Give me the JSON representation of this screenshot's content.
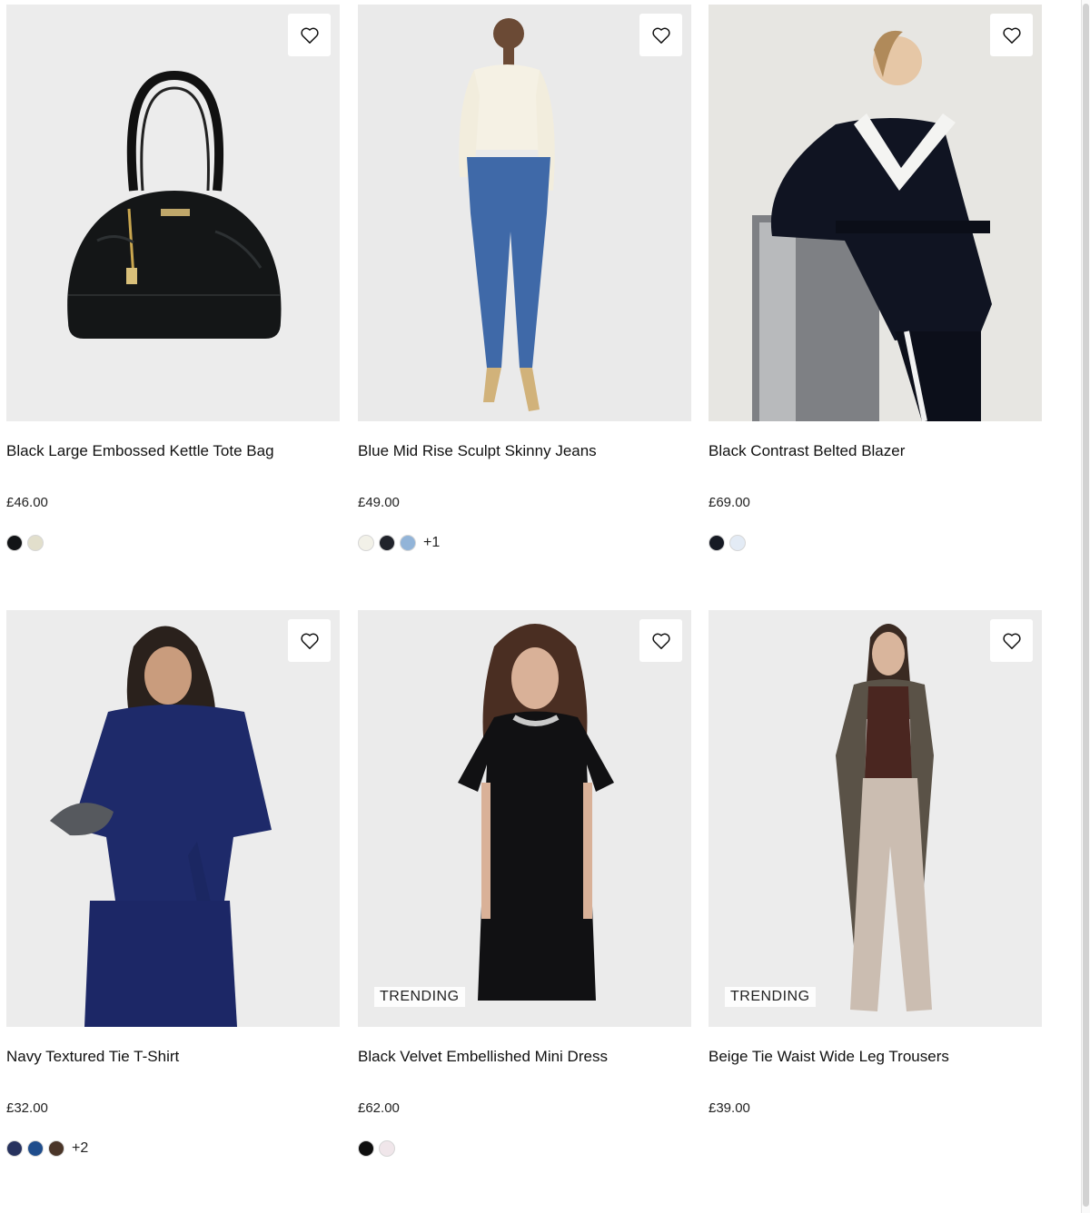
{
  "products": [
    {
      "title": "Black Large Embossed Kettle Tote Bag",
      "price": "£46.00",
      "swatches": [
        "#121416",
        "#e2dfcc"
      ],
      "more": "",
      "badge": "",
      "image": "product-photo-tote-bag",
      "bg": "#ececec"
    },
    {
      "title": "Blue Mid Rise Sculpt Skinny Jeans",
      "price": "£49.00",
      "swatches": [
        "#f2f1e8",
        "#20232b",
        "#92b4d8"
      ],
      "more": "+1",
      "badge": "",
      "image": "product-photo-skinny-jeans",
      "bg": "#eaeaea"
    },
    {
      "title": "Black Contrast Belted Blazer",
      "price": "£69.00",
      "swatches": [
        "#161a24",
        "#e3ebf5"
      ],
      "more": "",
      "badge": "",
      "image": "product-photo-belted-blazer",
      "bg": "#e7e6e2"
    },
    {
      "title": "Navy Textured Tie T-Shirt",
      "price": "£32.00",
      "swatches": [
        "#27325e",
        "#1f4d8c",
        "#4a3528"
      ],
      "more": "+2",
      "badge": "",
      "image": "product-photo-tie-tshirt",
      "bg": "#ececec"
    },
    {
      "title": "Black Velvet Embellished Mini Dress",
      "price": "£62.00",
      "swatches": [
        "#0e0e0e",
        "#f0e6ea"
      ],
      "more": "",
      "badge": "TRENDING",
      "image": "product-photo-mini-dress",
      "bg": "#ebebeb"
    },
    {
      "title": "Beige Tie Waist Wide Leg Trousers",
      "price": "£39.00",
      "swatches": [],
      "more": "",
      "badge": "TRENDING",
      "image": "product-photo-wide-leg-trousers",
      "bg": "#ececec"
    }
  ],
  "icons": {
    "wishlist": "heart-outline-icon"
  }
}
